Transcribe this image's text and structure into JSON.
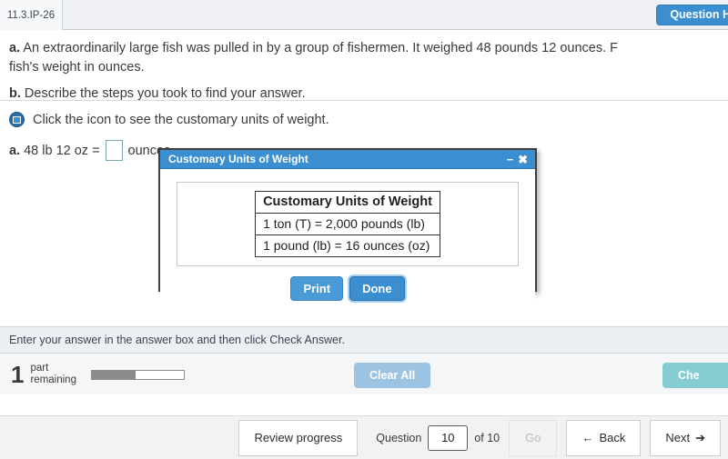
{
  "header": {
    "tab_label": "11.3.IP-26",
    "question_help_label": "Question H"
  },
  "question": {
    "part_a_label": "a.",
    "part_a_text_line1": "An extraordinarily large fish was pulled in by a group of fishermen. It weighed 48 pounds 12 ounces. F",
    "part_a_text_line2": "fish's weight in ounces.",
    "part_b_label": "b.",
    "part_b_text": "Describe the steps you took to find your answer.",
    "icon_instruction": "Click the icon to see the customary units of weight.",
    "icon_name": "units-of-weight-icon",
    "answer_label": "a.",
    "answer_prefix": "48 lb 12 oz =",
    "answer_value": "",
    "answer_suffix": "ounces"
  },
  "modal": {
    "title": "Customary Units of Weight",
    "minimize_icon": "−",
    "close_icon": "✖",
    "table": {
      "caption": "Customary Units of Weight",
      "rows": [
        "1 ton (T) = 2,000 pounds (lb)",
        "1 pound (lb) = 16 ounces (oz)"
      ]
    },
    "print_label": "Print",
    "done_label": "Done"
  },
  "hint_bar": {
    "text": "Enter your answer in the answer box and then click Check Answer."
  },
  "action_bar": {
    "parts_count": "1",
    "parts_label_line1": "part",
    "parts_label_line2": "remaining",
    "progress_percent": 48,
    "clear_all_label": "Clear All",
    "check_answer_label": "Che"
  },
  "nav_bar": {
    "review_progress_label": "Review progress",
    "question_label": "Question",
    "question_number": "10",
    "of_label": "of 10",
    "go_label": "Go",
    "back_label": "Back",
    "back_arrow": "←",
    "next_label": "Next",
    "next_arrow": "➔"
  },
  "colors": {
    "accent_blue": "#3b8ed0",
    "teal": "#85cdd2",
    "light_blue": "#9dc3e3"
  }
}
